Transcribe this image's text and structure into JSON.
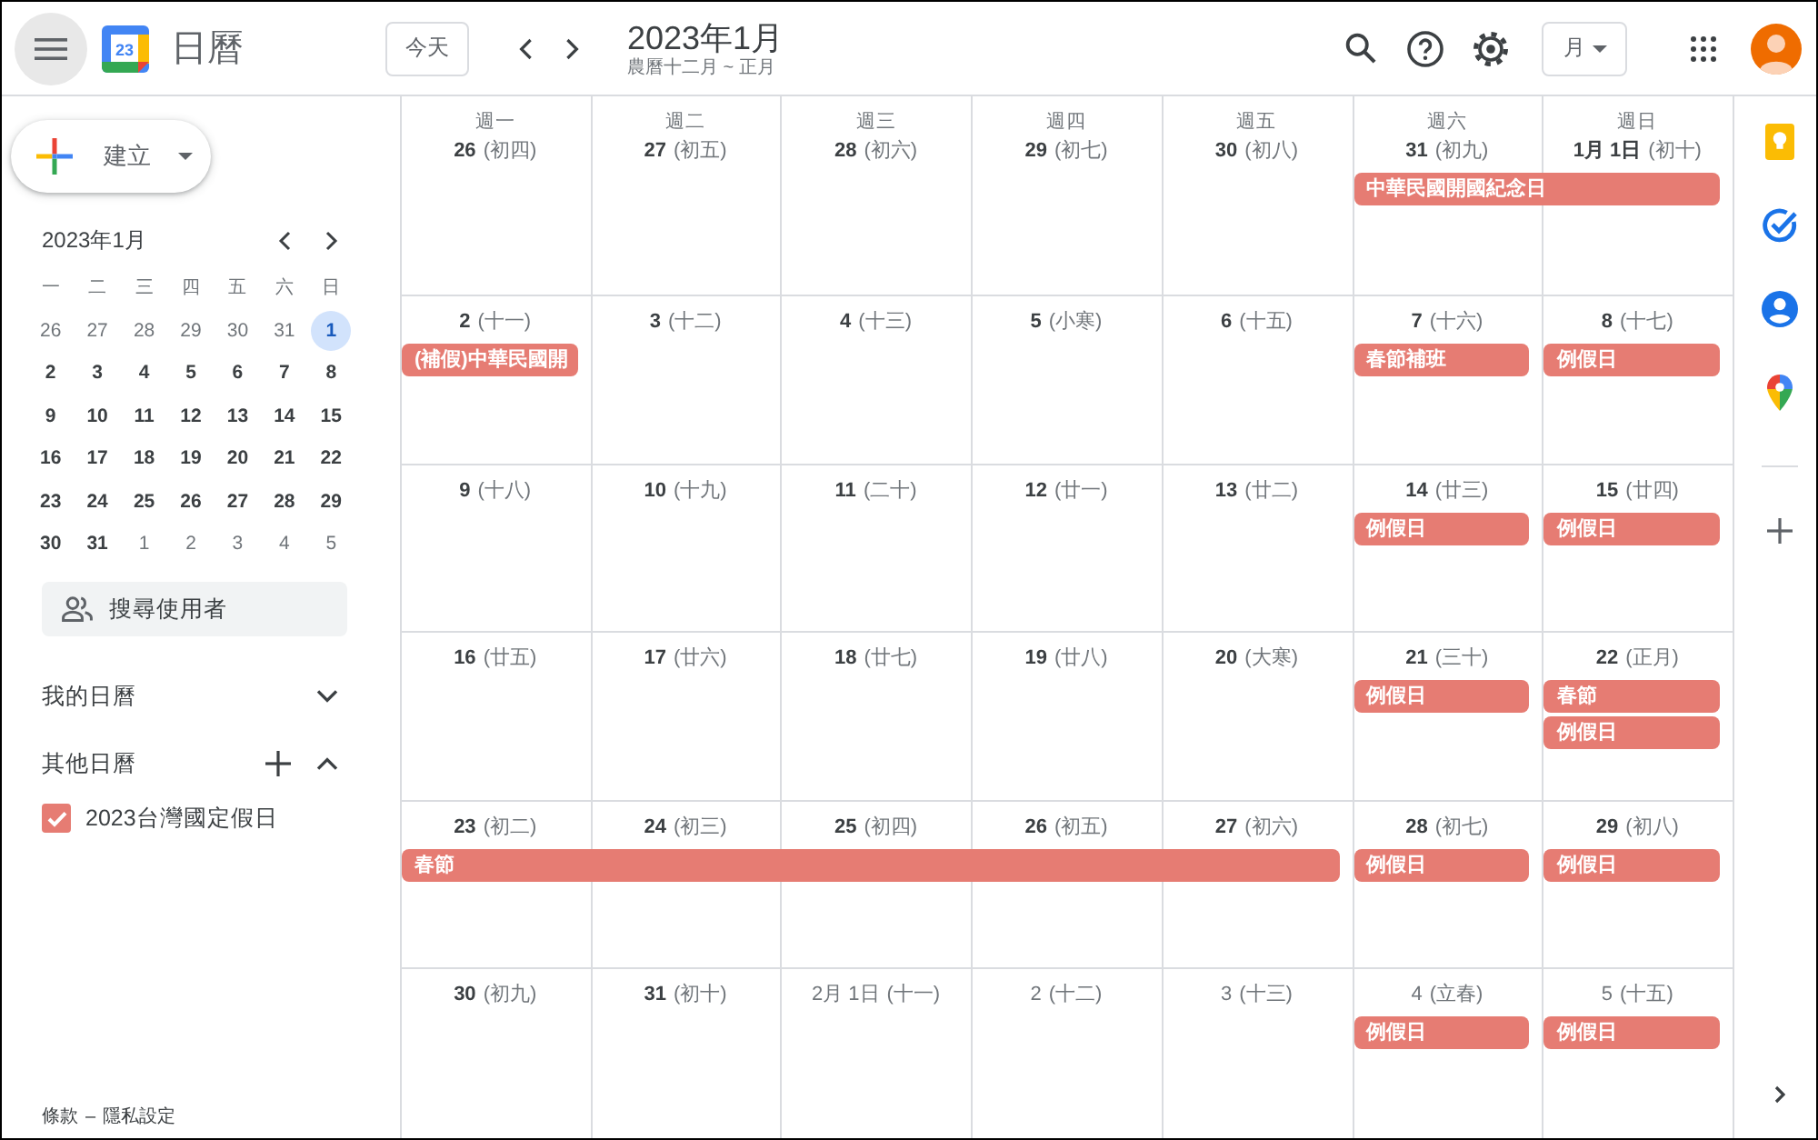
{
  "header": {
    "logo_text": "23",
    "app_name": "日曆",
    "today_button": "今天",
    "title": "2023年1月",
    "subtitle": "農曆十二月 ~ 正月",
    "view_selector": "月"
  },
  "sidebar": {
    "create_button": "建立",
    "mini_calendar": {
      "title": "2023年1月",
      "weekdays": [
        "一",
        "二",
        "三",
        "四",
        "五",
        "六",
        "日"
      ],
      "weeks": [
        [
          {
            "day": "26",
            "muted": true,
            "selected": false
          },
          {
            "day": "27",
            "muted": true,
            "selected": false
          },
          {
            "day": "28",
            "muted": true,
            "selected": false
          },
          {
            "day": "29",
            "muted": true,
            "selected": false
          },
          {
            "day": "30",
            "muted": true,
            "selected": false
          },
          {
            "day": "31",
            "muted": true,
            "selected": false
          },
          {
            "day": "1",
            "muted": false,
            "selected": true
          }
        ],
        [
          {
            "day": "2",
            "muted": false,
            "selected": false
          },
          {
            "day": "3",
            "muted": false,
            "selected": false
          },
          {
            "day": "4",
            "muted": false,
            "selected": false
          },
          {
            "day": "5",
            "muted": false,
            "selected": false
          },
          {
            "day": "6",
            "muted": false,
            "selected": false
          },
          {
            "day": "7",
            "muted": false,
            "selected": false
          },
          {
            "day": "8",
            "muted": false,
            "selected": false
          }
        ],
        [
          {
            "day": "9",
            "muted": false,
            "selected": false
          },
          {
            "day": "10",
            "muted": false,
            "selected": false
          },
          {
            "day": "11",
            "muted": false,
            "selected": false
          },
          {
            "day": "12",
            "muted": false,
            "selected": false
          },
          {
            "day": "13",
            "muted": false,
            "selected": false
          },
          {
            "day": "14",
            "muted": false,
            "selected": false
          },
          {
            "day": "15",
            "muted": false,
            "selected": false
          }
        ],
        [
          {
            "day": "16",
            "muted": false,
            "selected": false
          },
          {
            "day": "17",
            "muted": false,
            "selected": false
          },
          {
            "day": "18",
            "muted": false,
            "selected": false
          },
          {
            "day": "19",
            "muted": false,
            "selected": false
          },
          {
            "day": "20",
            "muted": false,
            "selected": false
          },
          {
            "day": "21",
            "muted": false,
            "selected": false
          },
          {
            "day": "22",
            "muted": false,
            "selected": false
          }
        ],
        [
          {
            "day": "23",
            "muted": false,
            "selected": false
          },
          {
            "day": "24",
            "muted": false,
            "selected": false
          },
          {
            "day": "25",
            "muted": false,
            "selected": false
          },
          {
            "day": "26",
            "muted": false,
            "selected": false
          },
          {
            "day": "27",
            "muted": false,
            "selected": false
          },
          {
            "day": "28",
            "muted": false,
            "selected": false
          },
          {
            "day": "29",
            "muted": false,
            "selected": false
          }
        ],
        [
          {
            "day": "30",
            "muted": false,
            "selected": false
          },
          {
            "day": "31",
            "muted": false,
            "selected": false
          },
          {
            "day": "1",
            "muted": true,
            "selected": false
          },
          {
            "day": "2",
            "muted": true,
            "selected": false
          },
          {
            "day": "3",
            "muted": true,
            "selected": false
          },
          {
            "day": "4",
            "muted": true,
            "selected": false
          },
          {
            "day": "5",
            "muted": true,
            "selected": false
          }
        ]
      ]
    },
    "search_people": {
      "placeholder": "搜尋使用者"
    },
    "sections": [
      {
        "title": "我的日曆",
        "can_add": false,
        "expanded": false
      },
      {
        "title": "其他日曆",
        "can_add": true,
        "expanded": true,
        "calendars": [
          {
            "name": "2023台灣國定假日",
            "checked": true,
            "color": "#e67c73"
          }
        ]
      }
    ],
    "footer": {
      "links": [
        "條款",
        "隱私設定"
      ],
      "separator": "–"
    }
  },
  "calendar": {
    "weekdays": [
      "週一",
      "週二",
      "週三",
      "週四",
      "週五",
      "週六",
      "週日"
    ],
    "weeks": [
      {
        "days": [
          {
            "date": "26",
            "lunar": "(初四)",
            "muted": false
          },
          {
            "date": "27",
            "lunar": "(初五)",
            "muted": false
          },
          {
            "date": "28",
            "lunar": "(初六)",
            "muted": false
          },
          {
            "date": "29",
            "lunar": "(初七)",
            "muted": false
          },
          {
            "date": "30",
            "lunar": "(初八)",
            "muted": false
          },
          {
            "date": "31",
            "lunar": "(初九)",
            "muted": false,
            "events": [
              {
                "title": "中華民國開國紀念日",
                "kind": "start"
              }
            ]
          },
          {
            "date": "1月 1日",
            "lunar": "(初十)",
            "muted": false,
            "events": [
              {
                "kind": "continued"
              }
            ]
          }
        ]
      },
      {
        "days": [
          {
            "date": "2",
            "lunar": "(十一)",
            "muted": false,
            "events": [
              {
                "title": "(補假)中華民國開",
                "kind": "single"
              }
            ]
          },
          {
            "date": "3",
            "lunar": "(十二)",
            "muted": false
          },
          {
            "date": "4",
            "lunar": "(十三)",
            "muted": false
          },
          {
            "date": "5",
            "lunar": "(小寒)",
            "muted": false
          },
          {
            "date": "6",
            "lunar": "(十五)",
            "muted": false
          },
          {
            "date": "7",
            "lunar": "(十六)",
            "muted": false,
            "events": [
              {
                "title": "春節補班",
                "kind": "single"
              }
            ]
          },
          {
            "date": "8",
            "lunar": "(十七)",
            "muted": false,
            "events": [
              {
                "title": "例假日",
                "kind": "single"
              }
            ]
          }
        ]
      },
      {
        "days": [
          {
            "date": "9",
            "lunar": "(十八)",
            "muted": false
          },
          {
            "date": "10",
            "lunar": "(十九)",
            "muted": false
          },
          {
            "date": "11",
            "lunar": "(二十)",
            "muted": false
          },
          {
            "date": "12",
            "lunar": "(廿一)",
            "muted": false
          },
          {
            "date": "13",
            "lunar": "(廿二)",
            "muted": false
          },
          {
            "date": "14",
            "lunar": "(廿三)",
            "muted": false,
            "events": [
              {
                "title": "例假日",
                "kind": "single"
              }
            ]
          },
          {
            "date": "15",
            "lunar": "(廿四)",
            "muted": false,
            "events": [
              {
                "title": "例假日",
                "kind": "single"
              }
            ]
          }
        ]
      },
      {
        "days": [
          {
            "date": "16",
            "lunar": "(廿五)",
            "muted": false
          },
          {
            "date": "17",
            "lunar": "(廿六)",
            "muted": false
          },
          {
            "date": "18",
            "lunar": "(廿七)",
            "muted": false
          },
          {
            "date": "19",
            "lunar": "(廿八)",
            "muted": false
          },
          {
            "date": "20",
            "lunar": "(大寒)",
            "muted": false
          },
          {
            "date": "21",
            "lunar": "(三十)",
            "muted": false,
            "events": [
              {
                "title": "例假日",
                "kind": "single"
              }
            ]
          },
          {
            "date": "22",
            "lunar": "(正月)",
            "muted": false,
            "events": [
              {
                "title": "春節",
                "kind": "single"
              },
              {
                "title": "例假日",
                "kind": "single"
              }
            ]
          }
        ]
      },
      {
        "days": [
          {
            "date": "23",
            "lunar": "(初二)",
            "muted": false,
            "events": [
              {
                "title": "春節",
                "kind": "start"
              }
            ]
          },
          {
            "date": "24",
            "lunar": "(初三)",
            "muted": false,
            "events": [
              {
                "kind": "continued"
              }
            ]
          },
          {
            "date": "25",
            "lunar": "(初四)",
            "muted": false,
            "events": [
              {
                "kind": "continued"
              }
            ]
          },
          {
            "date": "26",
            "lunar": "(初五)",
            "muted": false,
            "events": [
              {
                "kind": "continued"
              }
            ]
          },
          {
            "date": "27",
            "lunar": "(初六)",
            "muted": false,
            "events": [
              {
                "kind": "continued"
              }
            ]
          },
          {
            "date": "28",
            "lunar": "(初七)",
            "muted": false,
            "events": [
              {
                "title": "例假日",
                "kind": "single"
              }
            ]
          },
          {
            "date": "29",
            "lunar": "(初八)",
            "muted": false,
            "events": [
              {
                "title": "例假日",
                "kind": "single"
              }
            ]
          }
        ]
      },
      {
        "days": [
          {
            "date": "30",
            "lunar": "(初九)",
            "muted": false
          },
          {
            "date": "31",
            "lunar": "(初十)",
            "muted": false
          },
          {
            "date": "2月 1日",
            "lunar": "(十一)",
            "muted": true
          },
          {
            "date": "2",
            "lunar": "(十二)",
            "muted": true
          },
          {
            "date": "3",
            "lunar": "(十三)",
            "muted": true
          },
          {
            "date": "4",
            "lunar": "(立春)",
            "muted": true,
            "events": [
              {
                "title": "例假日",
                "kind": "single"
              }
            ]
          },
          {
            "date": "5",
            "lunar": "(十五)",
            "muted": true,
            "events": [
              {
                "title": "例假日",
                "kind": "single"
              }
            ]
          }
        ]
      }
    ]
  }
}
